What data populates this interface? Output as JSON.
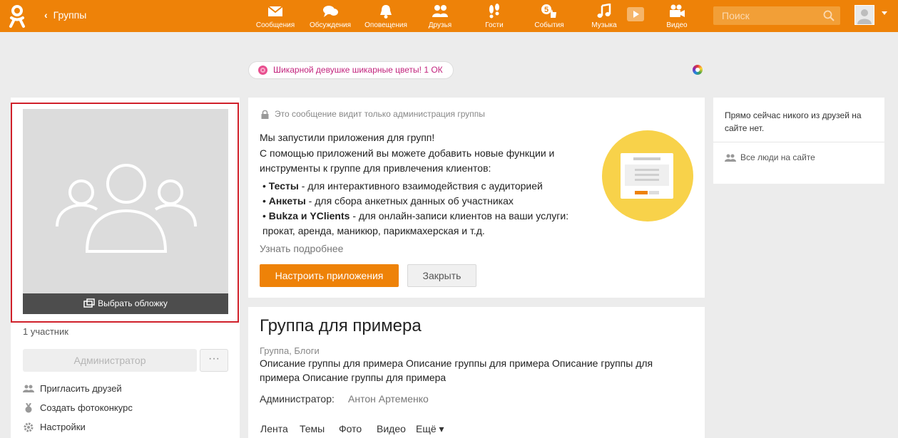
{
  "header": {
    "back_label": "Группы",
    "nav": [
      {
        "label": "Сообщения",
        "icon": "envelope-icon"
      },
      {
        "label": "Обсуждения",
        "icon": "chat-bubbles-icon"
      },
      {
        "label": "Оповещения",
        "icon": "bell-icon"
      },
      {
        "label": "Друзья",
        "icon": "friends-icon"
      },
      {
        "label": "Гости",
        "icon": "footprints-icon"
      },
      {
        "label": "События",
        "icon": "thumbs-up-icon",
        "badge": "5"
      },
      {
        "label": "Музыка",
        "icon": "music-note-icon"
      },
      {
        "label": "Видео",
        "icon": "video-camera-icon"
      }
    ],
    "search_placeholder": "Поиск",
    "brand_color": "#ee8208"
  },
  "gift": {
    "text": "Шикарной девушке шикарные цветы! 1 ОК",
    "icon": "rose-icon",
    "text_color": "#c2237d"
  },
  "left": {
    "cover_button": "Выбрать обложку",
    "members": "1 участник",
    "admin_button": "Администратор",
    "more_button": "···",
    "links": [
      {
        "label": "Пригласить друзей",
        "icon": "invite-friends-icon"
      },
      {
        "label": "Создать фотоконкурс",
        "icon": "medal-icon"
      },
      {
        "label": "Настройки",
        "icon": "gear-icon"
      }
    ]
  },
  "admin_message": {
    "notice": "Это сообщение видит только администрация группы",
    "lines": [
      "Мы запустили приложения для групп!",
      "С помощью приложений вы можете добавить новые функции и",
      "инструменты к группе для привлечения клиентов:"
    ],
    "bullets": [
      {
        "bold": "Тесты",
        "text": " - для интерактивного взаимодействия с аудиторией"
      },
      {
        "bold": "Анкеты",
        "text": " - для сбора анкетных данных об участниках"
      },
      {
        "bold": "Bukza и YClients",
        "text": " - для онлайн-записи клиентов на ваши услуги:"
      }
    ],
    "bullet_continuation": "прокат, аренда, маникюр, парикмахерская и т.д.",
    "more_link": "Узнать подробнее",
    "setup_button": "Настроить приложения",
    "close_button": "Закрыть"
  },
  "group": {
    "title": "Группа для примера",
    "category": "Группа, Блоги",
    "description": "Описание группы для примера Описание группы для примера Описание группы для примера Описание группы для примера",
    "admin_label": "Администратор:",
    "admin_name": "Антон Артеменко",
    "tabs": [
      "Лента",
      "Темы",
      "Фото",
      "Видео",
      "Ещё ▾"
    ]
  },
  "right": {
    "text": "Прямо сейчас никого из друзей на сайте нет.",
    "all_people_link": "Все люди на сайте"
  }
}
